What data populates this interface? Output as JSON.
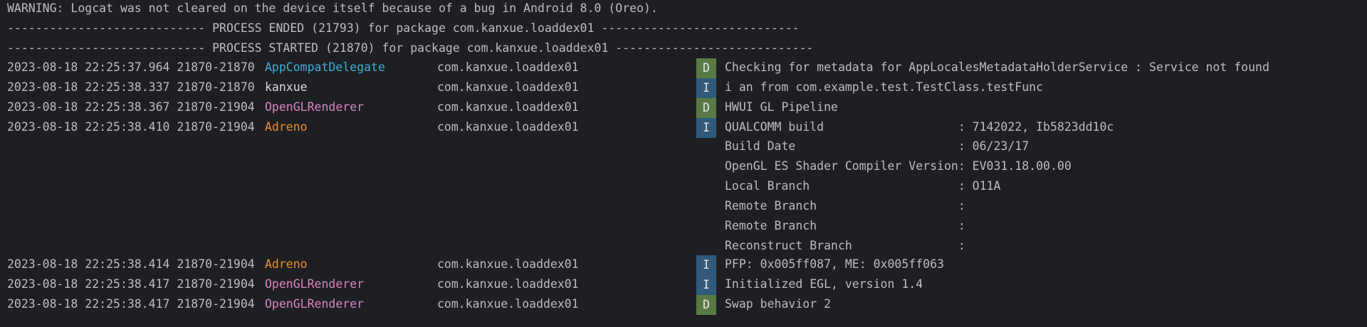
{
  "colors": {
    "background": "#1e1f22",
    "text": "#bcbec4",
    "tag_appcompat": "#3fb0d8",
    "tag_kanxue": "#dcdcdc",
    "tag_opengl": "#d886c4",
    "tag_adreno": "#e8902b",
    "level_debug": "#5a7a45",
    "level_info": "#2f5a7a"
  },
  "header_lines": [
    "WARNING: Logcat was not cleared on the device itself because of a bug in Android 8.0 (Oreo).",
    "---------------------------- PROCESS ENDED (21793) for package com.kanxue.loaddex01 ----------------------------",
    "---------------------------- PROCESS STARTED (21870) for package com.kanxue.loaddex01 ----------------------------"
  ],
  "log_rows": [
    {
      "timestamp": "2023-08-18 22:25:37.964 21870-21870",
      "tag": "AppCompatDelegate",
      "tag_color": "#3fb0d8",
      "package": "com.kanxue.loaddex01",
      "level": "D",
      "message": "Checking for metadata for AppLocalesMetadataHolderService : Service not found"
    },
    {
      "timestamp": "2023-08-18 22:25:38.337 21870-21870",
      "tag": "kanxue",
      "tag_color": "#dcdcdc",
      "package": "com.kanxue.loaddex01",
      "level": "I",
      "message": "i an from com.example.test.TestClass.testFunc"
    },
    {
      "timestamp": "2023-08-18 22:25:38.367 21870-21904",
      "tag": "OpenGLRenderer",
      "tag_color": "#d886c4",
      "package": "com.kanxue.loaddex01",
      "level": "D",
      "message": "HWUI GL Pipeline"
    },
    {
      "timestamp": "2023-08-18 22:25:38.410 21870-21904",
      "tag": "Adreno",
      "tag_color": "#e8902b",
      "package": "com.kanxue.loaddex01",
      "level": "I",
      "message": "QUALCOMM build                   : 7142022, Ib5823dd10c"
    }
  ],
  "continuation_lines": [
    "Build Date                       : 06/23/17",
    "OpenGL ES Shader Compiler Version: EV031.18.00.00",
    "Local Branch                     : O11A",
    "Remote Branch                    :",
    "Remote Branch                    :",
    "Reconstruct Branch               :"
  ],
  "log_rows_after": [
    {
      "timestamp": "2023-08-18 22:25:38.414 21870-21904",
      "tag": "Adreno",
      "tag_color": "#e8902b",
      "package": "com.kanxue.loaddex01",
      "level": "I",
      "message": "PFP: 0x005ff087, ME: 0x005ff063"
    },
    {
      "timestamp": "2023-08-18 22:25:38.417 21870-21904",
      "tag": "OpenGLRenderer",
      "tag_color": "#d886c4",
      "package": "com.kanxue.loaddex01",
      "level": "I",
      "message": "Initialized EGL, version 1.4"
    },
    {
      "timestamp": "2023-08-18 22:25:38.417 21870-21904",
      "tag": "OpenGLRenderer",
      "tag_color": "#d886c4",
      "package": "com.kanxue.loaddex01",
      "level": "D",
      "message": "Swap behavior 2"
    }
  ]
}
